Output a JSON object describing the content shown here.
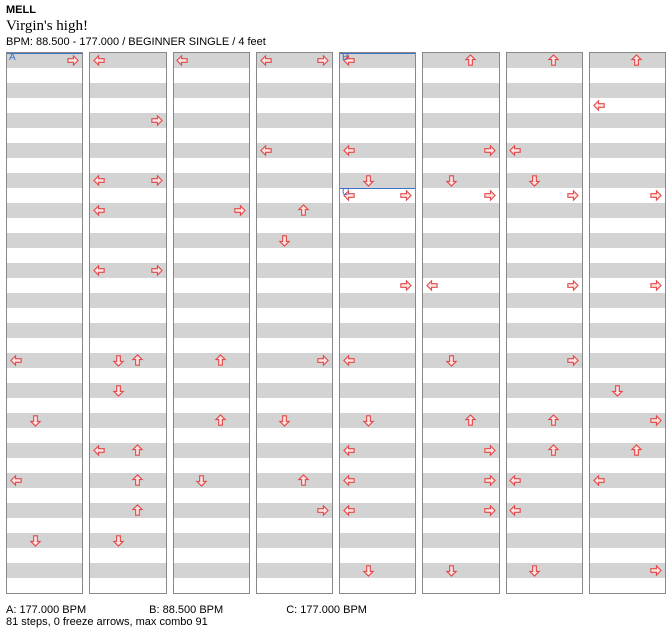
{
  "header": {
    "artist": "MELL",
    "title": "Virgin's high!",
    "meta": "BPM: 88.500 - 177.000 / BEGINNER SINGLE / 4 feet"
  },
  "footer": {
    "markers": [
      "A: 177.000 BPM",
      "B: 88.500 BPM",
      "C: 177.000 BPM"
    ],
    "stats": "81 steps, 0 freeze arrows, max combo 91"
  },
  "lanes": [
    "L",
    "D",
    "U",
    "R"
  ],
  "beats_per_column": 36,
  "markers": [
    {
      "label": "A",
      "col": 0,
      "beat": 0
    },
    {
      "label": "B",
      "col": 4,
      "beat": 0
    },
    {
      "label": "C",
      "col": 4,
      "beat": 9
    }
  ],
  "columns": [
    [
      {
        "b": 0,
        "a": [
          "R"
        ]
      },
      {
        "b": 20,
        "a": [
          "L"
        ]
      },
      {
        "b": 24,
        "a": [
          "D"
        ]
      },
      {
        "b": 28,
        "a": [
          "L"
        ]
      },
      {
        "b": 32,
        "a": [
          "D"
        ]
      }
    ],
    [
      {
        "b": 0,
        "a": [
          "L"
        ]
      },
      {
        "b": 4,
        "a": [
          "R"
        ]
      },
      {
        "b": 8,
        "a": [
          "L",
          "R"
        ]
      },
      {
        "b": 10,
        "a": [
          "L"
        ]
      },
      {
        "b": 14,
        "a": [
          "L",
          "R"
        ]
      },
      {
        "b": 20,
        "a": [
          "D",
          "U"
        ]
      },
      {
        "b": 22,
        "a": [
          "D"
        ]
      },
      {
        "b": 26,
        "a": [
          "L",
          "U"
        ]
      },
      {
        "b": 28,
        "a": [
          "U"
        ]
      },
      {
        "b": 30,
        "a": [
          "U"
        ]
      },
      {
        "b": 32,
        "a": [
          "D"
        ]
      }
    ],
    [
      {
        "b": 0,
        "a": [
          "L"
        ]
      },
      {
        "b": 10,
        "a": [
          "R"
        ]
      },
      {
        "b": 20,
        "a": [
          "U"
        ]
      },
      {
        "b": 24,
        "a": [
          "U"
        ]
      },
      {
        "b": 28,
        "a": [
          "D"
        ]
      }
    ],
    [
      {
        "b": 0,
        "a": [
          "L",
          "R"
        ]
      },
      {
        "b": 6,
        "a": [
          "L"
        ]
      },
      {
        "b": 10,
        "a": [
          "U"
        ]
      },
      {
        "b": 12,
        "a": [
          "D"
        ]
      },
      {
        "b": 20,
        "a": [
          "R"
        ]
      },
      {
        "b": 24,
        "a": [
          "D"
        ]
      },
      {
        "b": 28,
        "a": [
          "U"
        ]
      },
      {
        "b": 30,
        "a": [
          "R"
        ]
      }
    ],
    [
      {
        "b": 0,
        "a": [
          "L"
        ]
      },
      {
        "b": 6,
        "a": [
          "L"
        ]
      },
      {
        "b": 8,
        "a": [
          "D"
        ]
      },
      {
        "b": 9,
        "a": [
          "L",
          "R"
        ]
      },
      {
        "b": 15,
        "a": [
          "R"
        ]
      },
      {
        "b": 20,
        "a": [
          "L"
        ]
      },
      {
        "b": 24,
        "a": [
          "D"
        ]
      },
      {
        "b": 26,
        "a": [
          "L"
        ]
      },
      {
        "b": 28,
        "a": [
          "L"
        ]
      },
      {
        "b": 30,
        "a": [
          "L"
        ]
      },
      {
        "b": 34,
        "a": [
          "D"
        ]
      }
    ],
    [
      {
        "b": 0,
        "a": [
          "U"
        ]
      },
      {
        "b": 6,
        "a": [
          "R"
        ]
      },
      {
        "b": 8,
        "a": [
          "D"
        ]
      },
      {
        "b": 9,
        "a": [
          "R"
        ]
      },
      {
        "b": 15,
        "a": [
          "L"
        ]
      },
      {
        "b": 20,
        "a": [
          "D"
        ]
      },
      {
        "b": 24,
        "a": [
          "U"
        ]
      },
      {
        "b": 26,
        "a": [
          "R"
        ]
      },
      {
        "b": 28,
        "a": [
          "R"
        ]
      },
      {
        "b": 30,
        "a": [
          "R"
        ]
      },
      {
        "b": 34,
        "a": [
          "D"
        ]
      }
    ],
    [
      {
        "b": 0,
        "a": [
          "U"
        ]
      },
      {
        "b": 6,
        "a": [
          "L"
        ]
      },
      {
        "b": 8,
        "a": [
          "D"
        ]
      },
      {
        "b": 9,
        "a": [
          "R"
        ]
      },
      {
        "b": 15,
        "a": [
          "R"
        ]
      },
      {
        "b": 20,
        "a": [
          "R"
        ]
      },
      {
        "b": 24,
        "a": [
          "U"
        ]
      },
      {
        "b": 26,
        "a": [
          "U"
        ]
      },
      {
        "b": 28,
        "a": [
          "L"
        ]
      },
      {
        "b": 30,
        "a": [
          "L"
        ]
      },
      {
        "b": 34,
        "a": [
          "D"
        ]
      }
    ],
    [
      {
        "b": 0,
        "a": [
          "U"
        ]
      },
      {
        "b": 3,
        "a": [
          "L"
        ]
      },
      {
        "b": 9,
        "a": [
          "R"
        ]
      },
      {
        "b": 15,
        "a": [
          "R"
        ]
      },
      {
        "b": 22,
        "a": [
          "D"
        ]
      },
      {
        "b": 24,
        "a": [
          "R"
        ]
      },
      {
        "b": 26,
        "a": [
          "U"
        ]
      },
      {
        "b": 28,
        "a": [
          "L"
        ]
      },
      {
        "b": 34,
        "a": [
          "R"
        ]
      }
    ]
  ],
  "chart_data": {
    "type": "table",
    "title": "Virgin's high! — BEGINNER SINGLE step chart",
    "lanes": [
      "Left",
      "Down",
      "Up",
      "Right"
    ],
    "bpm_range": [
      88.5,
      177.0
    ],
    "difficulty": "BEGINNER SINGLE",
    "feet": 4,
    "step_count": 81,
    "freeze_arrows": 0,
    "max_combo": 91,
    "bpm_markers": [
      {
        "label": "A",
        "bpm": 177.0,
        "column": 1,
        "beat": 0
      },
      {
        "label": "B",
        "bpm": 88.5,
        "column": 5,
        "beat": 0
      },
      {
        "label": "C",
        "bpm": 177.0,
        "column": 5,
        "beat": 9
      }
    ],
    "columns_beats": 36,
    "steps_by_column": [
      [
        {
          "beat": 0,
          "arrows": [
            "R"
          ]
        },
        {
          "beat": 20,
          "arrows": [
            "L"
          ]
        },
        {
          "beat": 24,
          "arrows": [
            "D"
          ]
        },
        {
          "beat": 28,
          "arrows": [
            "L"
          ]
        },
        {
          "beat": 32,
          "arrows": [
            "D"
          ]
        }
      ],
      [
        {
          "beat": 0,
          "arrows": [
            "L"
          ]
        },
        {
          "beat": 4,
          "arrows": [
            "R"
          ]
        },
        {
          "beat": 8,
          "arrows": [
            "L",
            "R"
          ]
        },
        {
          "beat": 10,
          "arrows": [
            "L"
          ]
        },
        {
          "beat": 14,
          "arrows": [
            "L",
            "R"
          ]
        },
        {
          "beat": 20,
          "arrows": [
            "D",
            "U"
          ]
        },
        {
          "beat": 22,
          "arrows": [
            "D"
          ]
        },
        {
          "beat": 26,
          "arrows": [
            "L",
            "U"
          ]
        },
        {
          "beat": 28,
          "arrows": [
            "U"
          ]
        },
        {
          "beat": 30,
          "arrows": [
            "U"
          ]
        },
        {
          "beat": 32,
          "arrows": [
            "D"
          ]
        }
      ],
      [
        {
          "beat": 0,
          "arrows": [
            "L"
          ]
        },
        {
          "beat": 10,
          "arrows": [
            "R"
          ]
        },
        {
          "beat": 20,
          "arrows": [
            "U"
          ]
        },
        {
          "beat": 24,
          "arrows": [
            "U"
          ]
        },
        {
          "beat": 28,
          "arrows": [
            "D"
          ]
        }
      ],
      [
        {
          "beat": 0,
          "arrows": [
            "L",
            "R"
          ]
        },
        {
          "beat": 6,
          "arrows": [
            "L"
          ]
        },
        {
          "beat": 10,
          "arrows": [
            "U"
          ]
        },
        {
          "beat": 12,
          "arrows": [
            "D"
          ]
        },
        {
          "beat": 20,
          "arrows": [
            "R"
          ]
        },
        {
          "beat": 24,
          "arrows": [
            "D"
          ]
        },
        {
          "beat": 28,
          "arrows": [
            "U"
          ]
        },
        {
          "beat": 30,
          "arrows": [
            "R"
          ]
        }
      ],
      [
        {
          "beat": 0,
          "arrows": [
            "L"
          ]
        },
        {
          "beat": 6,
          "arrows": [
            "L"
          ]
        },
        {
          "beat": 8,
          "arrows": [
            "D"
          ]
        },
        {
          "beat": 9,
          "arrows": [
            "L",
            "R"
          ]
        },
        {
          "beat": 15,
          "arrows": [
            "R"
          ]
        },
        {
          "beat": 20,
          "arrows": [
            "L"
          ]
        },
        {
          "beat": 24,
          "arrows": [
            "D"
          ]
        },
        {
          "beat": 26,
          "arrows": [
            "L"
          ]
        },
        {
          "beat": 28,
          "arrows": [
            "L"
          ]
        },
        {
          "beat": 30,
          "arrows": [
            "L"
          ]
        },
        {
          "beat": 34,
          "arrows": [
            "D"
          ]
        }
      ],
      [
        {
          "beat": 0,
          "arrows": [
            "U"
          ]
        },
        {
          "beat": 6,
          "arrows": [
            "R"
          ]
        },
        {
          "beat": 8,
          "arrows": [
            "D"
          ]
        },
        {
          "beat": 9,
          "arrows": [
            "R"
          ]
        },
        {
          "beat": 15,
          "arrows": [
            "L"
          ]
        },
        {
          "beat": 20,
          "arrows": [
            "D"
          ]
        },
        {
          "beat": 24,
          "arrows": [
            "U"
          ]
        },
        {
          "beat": 26,
          "arrows": [
            "R"
          ]
        },
        {
          "beat": 28,
          "arrows": [
            "R"
          ]
        },
        {
          "beat": 30,
          "arrows": [
            "R"
          ]
        },
        {
          "beat": 34,
          "arrows": [
            "D"
          ]
        }
      ],
      [
        {
          "beat": 0,
          "arrows": [
            "U"
          ]
        },
        {
          "beat": 6,
          "arrows": [
            "L"
          ]
        },
        {
          "beat": 8,
          "arrows": [
            "D"
          ]
        },
        {
          "beat": 9,
          "arrows": [
            "R"
          ]
        },
        {
          "beat": 15,
          "arrows": [
            "R"
          ]
        },
        {
          "beat": 20,
          "arrows": [
            "R"
          ]
        },
        {
          "beat": 24,
          "arrows": [
            "U"
          ]
        },
        {
          "beat": 26,
          "arrows": [
            "U"
          ]
        },
        {
          "beat": 28,
          "arrows": [
            "L"
          ]
        },
        {
          "beat": 30,
          "arrows": [
            "L"
          ]
        },
        {
          "beat": 34,
          "arrows": [
            "D"
          ]
        }
      ],
      [
        {
          "beat": 0,
          "arrows": [
            "U"
          ]
        },
        {
          "beat": 3,
          "arrows": [
            "L"
          ]
        },
        {
          "beat": 9,
          "arrows": [
            "R"
          ]
        },
        {
          "beat": 15,
          "arrows": [
            "R"
          ]
        },
        {
          "beat": 22,
          "arrows": [
            "D"
          ]
        },
        {
          "beat": 24,
          "arrows": [
            "R"
          ]
        },
        {
          "beat": 26,
          "arrows": [
            "U"
          ]
        },
        {
          "beat": 28,
          "arrows": [
            "L"
          ]
        },
        {
          "beat": 34,
          "arrows": [
            "R"
          ]
        }
      ]
    ]
  }
}
